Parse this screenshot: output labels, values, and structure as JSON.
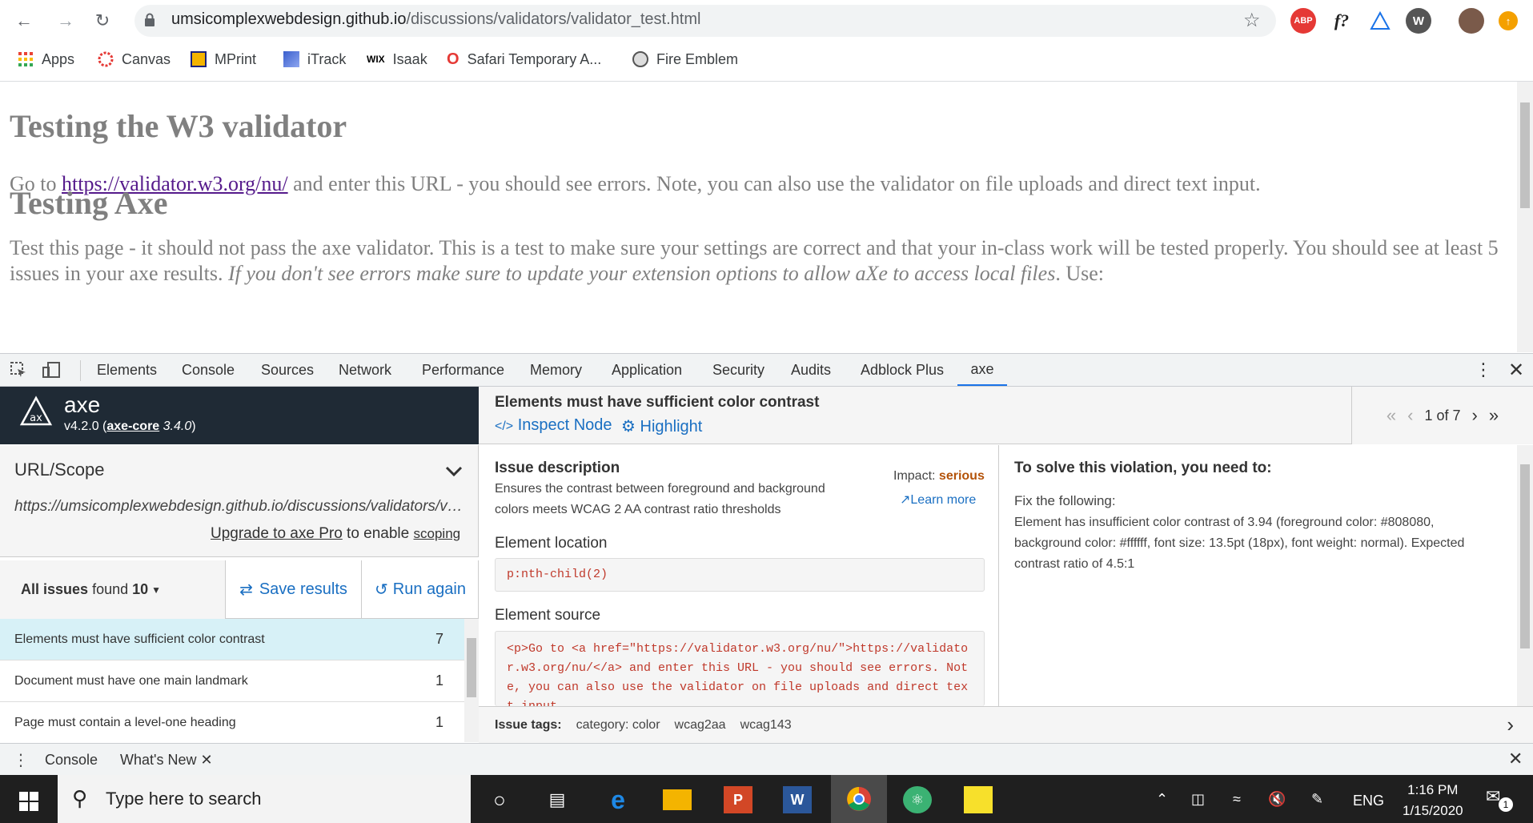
{
  "browser": {
    "url_host": "umsicomplexwebdesign.github.io",
    "url_path": "/discussions/validators/validator_test.html",
    "extensions": [
      "ABP",
      "f?"
    ],
    "bookmarks": [
      {
        "label": "Apps",
        "icon": "apps-grid-icon",
        "color": "#e53935"
      },
      {
        "label": "Canvas",
        "icon": "canvas-icon",
        "color": "#e53935"
      },
      {
        "label": "MPrint",
        "icon": "mprint-icon",
        "color": "#f4b400"
      },
      {
        "label": "iTrack",
        "icon": "itrack-icon",
        "color": "#3a5fcd"
      },
      {
        "label": "Isaak",
        "icon": "wix-icon",
        "color": "#000000"
      },
      {
        "label": "Safari Temporary A...",
        "icon": "safari-temp-icon",
        "color": "#e53935"
      },
      {
        "label": "Fire Emblem",
        "icon": "fire-emblem-icon",
        "color": "#555555"
      }
    ]
  },
  "page": {
    "h1": "Testing the W3 validator",
    "p1_before": "Go to ",
    "p1_link": "https://validator.w3.org/nu/",
    "p1_after": " and enter this URL - you should see errors. Note, you can also use the validator on file uploads and direct text input.",
    "h2": "Testing Axe",
    "p2_a": "Test this page - it should not pass the axe validator. This is a test to make sure your settings are correct and that your in-class work will be tested properly. You should see at least 5 issues in your axe results. ",
    "p2_em": "If you don't see errors make sure to update your extension options to allow aXe to access local files",
    "p2_b": ". Use:"
  },
  "devtools": {
    "tabs": [
      "Elements",
      "Console",
      "Sources",
      "Network",
      "Performance",
      "Memory",
      "Application",
      "Security",
      "Audits",
      "Adblock Plus",
      "axe"
    ],
    "active_tab": "axe",
    "drawer_tabs": [
      "Console",
      "What's New"
    ]
  },
  "axe": {
    "name": "axe",
    "version": "v4.2.0",
    "core_label": "axe-core",
    "core_version": "3.4.0",
    "scope_title": "URL/Scope",
    "scope_url": "https://umsicomplexwebdesign.github.io/discussions/validators/validator_test.html",
    "upgrade_link": "Upgrade to axe Pro",
    "upgrade_mid": " to enable ",
    "upgrade_scoping": "scoping",
    "all_issues_label": "All issues",
    "found_label": "found",
    "found_count": "10",
    "save_label": "Save results",
    "run_label": "Run again",
    "issues": [
      {
        "title": "Elements must have sufficient color contrast",
        "count": "7",
        "selected": true
      },
      {
        "title": "Document must have one main landmark",
        "count": "1",
        "selected": false
      },
      {
        "title": "Page must contain a level-one heading",
        "count": "1",
        "selected": false
      }
    ]
  },
  "detail": {
    "title": "Elements must have sufficient color contrast",
    "inspect_label": "Inspect Node",
    "highlight_label": "Highlight",
    "pager": "1 of 7",
    "issue_desc_label": "Issue description",
    "issue_desc": "Ensures the contrast between foreground and background colors meets WCAG 2 AA contrast ratio thresholds",
    "impact_label": "Impact:",
    "impact_value": "serious",
    "learn_more": "Learn more",
    "location_label": "Element location",
    "location": "p:nth-child(2)",
    "source_label": "Element source",
    "source": "<p>Go to <a href=\"https://validator.w3.org/nu/\">https://validator.w3.org/nu/</a> and enter this URL - you should see errors. Note, you can also use the validator on file uploads and direct text input.",
    "solve_title": "To solve this violation, you need to:",
    "fix_title": "Fix the following:",
    "fix_text": "Element has insufficient color contrast of 3.94 (foreground color: #808080, background color: #ffffff, font size: 13.5pt (18px), font weight: normal). Expected contrast ratio of 4.5:1",
    "tags_label": "Issue tags:",
    "tags": [
      "category: color",
      "wcag2aa",
      "wcag143"
    ]
  },
  "taskbar": {
    "search_placeholder": "Type here to search",
    "time": "1:16 PM",
    "date": "1/15/2020",
    "lang": "ENG",
    "notif_count": "1"
  }
}
